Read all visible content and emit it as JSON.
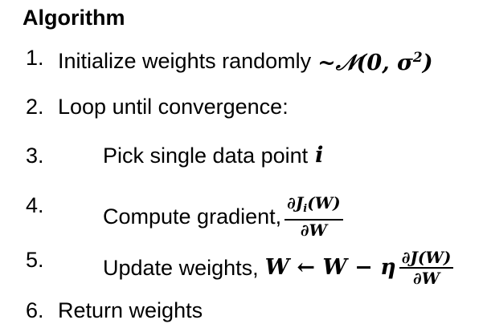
{
  "title": "Algorithm",
  "steps": [
    {
      "number": "1.",
      "text": "Initialize weights randomly",
      "math": "~𝒩(0, σ",
      "sup": "2",
      "math_end": ")"
    },
    {
      "number": "2.",
      "text": "Loop until convergence:"
    },
    {
      "number": "3.",
      "text": "Pick single data point",
      "math": "i"
    },
    {
      "number": "4.",
      "text": "Compute gradient,",
      "frac_num": "∂J",
      "frac_num_sub": "i",
      "frac_num_end": "(W)",
      "frac_den": "∂W"
    },
    {
      "number": "5.",
      "text": "Update weights,",
      "math": "W ← W − η",
      "frac_num": "∂J(W)",
      "frac_den": "∂W"
    },
    {
      "number": "6.",
      "text": "Return weights"
    }
  ]
}
